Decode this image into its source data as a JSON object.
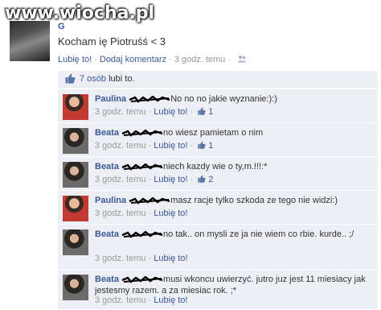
{
  "watermark": "www.wiocha.pl",
  "post": {
    "author": "G",
    "text": "Kocham ię Piotruśś < 3",
    "like_label": "Lubię to!",
    "comment_label": "Dodaj komentarz",
    "time": "3 godz. temu",
    "separator": "·"
  },
  "likes": {
    "count_text": "7 osób",
    "suffix": " lubi to."
  },
  "comments": [
    {
      "name": "Paulina",
      "text": "No no no jakie wyznanie:):)",
      "time": "3 godz. temu",
      "like_label": "Lubię to!",
      "like_count": "1"
    },
    {
      "name": "Beata",
      "text": "no wiesz pamietam o nim",
      "time": "3 godz. temu",
      "like_label": "Lubię to!",
      "like_count": "1"
    },
    {
      "name": "Beata",
      "text": "niech kazdy wie o ty,m.!!!:*",
      "time": "3 godz. temu",
      "like_label": "Lubię to!",
      "like_count": "2"
    },
    {
      "name": "Paulina",
      "text": "masz racje tylko szkoda ze tego nie widzi:)",
      "time": "3 godz. temu",
      "like_label": "Lubię to!",
      "like_count": ""
    },
    {
      "name": "Beata",
      "text": "no tak.. on mysli ze ja nie wiem co rbie. kurde.. ;/",
      "time": "3 godz. temu",
      "like_label": "Lubię to!",
      "like_count": ""
    },
    {
      "name": "Beata",
      "text": "musi wkoncu uwierzyć. jutro juz jest 11 miesiacy jak jestesmy razem. a za miesiac rok. ;*",
      "time": "3 godz. temu",
      "like_label": "Lubię to!",
      "like_count": ""
    }
  ],
  "colors": {
    "link": "#3b5998",
    "panel": "#edeff4",
    "muted": "#999999"
  }
}
